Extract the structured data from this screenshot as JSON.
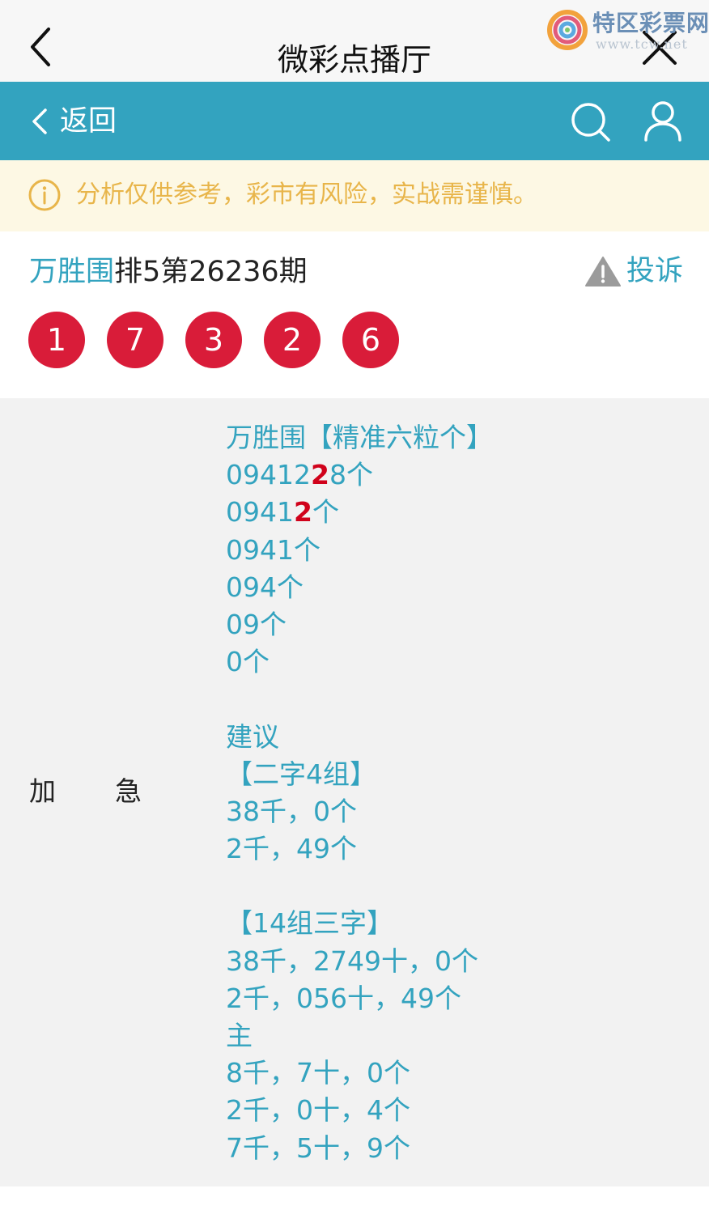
{
  "window": {
    "title": "微彩点播厅"
  },
  "watermark": {
    "name": "特区彩票网",
    "site": "www.tcw.net"
  },
  "nav": {
    "back_label": "返回"
  },
  "notice": {
    "text": "分析仅供参考，彩市有风险，实战需谨慎。"
  },
  "header": {
    "author": "万胜围",
    "issue": "排5第26236期",
    "complain_label": "投诉",
    "balls": [
      "1",
      "7",
      "3",
      "2",
      "6"
    ]
  },
  "content": {
    "label_left": "加",
    "label_right": "急",
    "lines": [
      {
        "before": "万胜围【精准六粒个】",
        "hl": "",
        "after": ""
      },
      {
        "before": "09412",
        "hl": "2",
        "after": "8个"
      },
      {
        "before": "0941",
        "hl": "2",
        "after": "个"
      },
      {
        "before": "0941个",
        "hl": "",
        "after": ""
      },
      {
        "before": "094个",
        "hl": "",
        "after": ""
      },
      {
        "before": "09个",
        "hl": "",
        "after": ""
      },
      {
        "before": "0个",
        "hl": "",
        "after": ""
      },
      {
        "before": "",
        "hl": "",
        "after": ""
      },
      {
        "before": "建议",
        "hl": "",
        "after": ""
      },
      {
        "before": "【二字4组】",
        "hl": "",
        "after": ""
      },
      {
        "before": "38千，0个",
        "hl": "",
        "after": ""
      },
      {
        "before": "2千，49个",
        "hl": "",
        "after": ""
      },
      {
        "before": "",
        "hl": "",
        "after": ""
      },
      {
        "before": "【14组三字】",
        "hl": "",
        "after": ""
      },
      {
        "before": "38千，2749十，0个",
        "hl": "",
        "after": ""
      },
      {
        "before": "2千，056十，49个",
        "hl": "",
        "after": ""
      },
      {
        "before": "主",
        "hl": "",
        "after": ""
      },
      {
        "before": "8千，7十，0个",
        "hl": "",
        "after": ""
      },
      {
        "before": "2千，0十，4个",
        "hl": "",
        "after": ""
      },
      {
        "before": "7千，5十，9个",
        "hl": "",
        "after": ""
      }
    ]
  },
  "colors": {
    "accent": "#33a3bf",
    "ball": "#d91c39",
    "highlight": "#d0021b",
    "notice_text": "#e8b54a",
    "notice_bg": "#fdf8e4"
  },
  "icons": [
    "chevron-left-icon",
    "close-icon",
    "search-icon",
    "user-icon",
    "info-icon",
    "warning-icon",
    "logo-swirl-icon"
  ]
}
